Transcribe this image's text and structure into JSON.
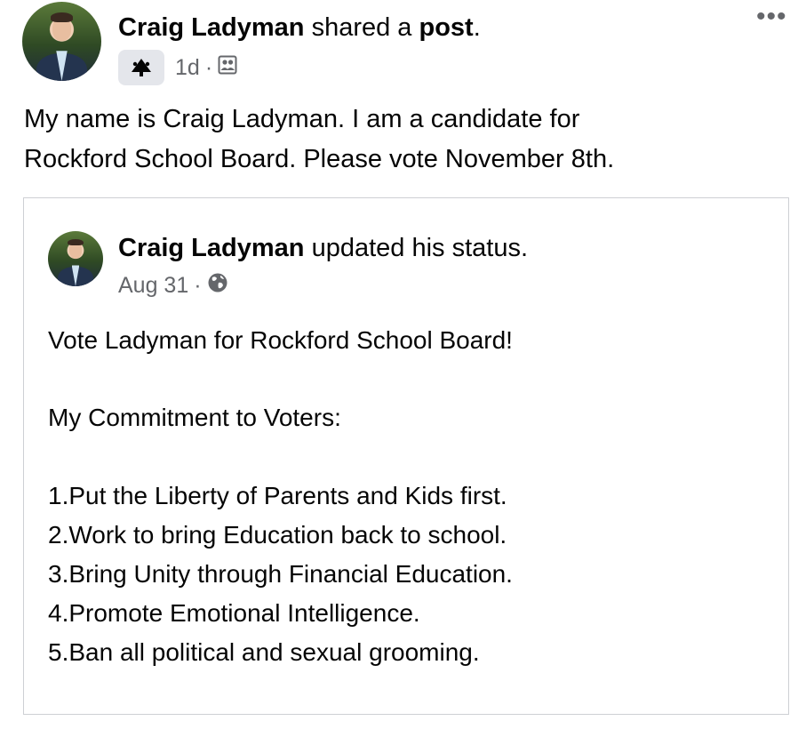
{
  "post": {
    "author": "Craig Ladyman",
    "action_middle": "shared a",
    "action_object": "post",
    "action_end": ".",
    "time": "1d",
    "separator": "·",
    "text_line1": "My name is Craig Ladyman. I am a candidate for",
    "text_line2": "Rockford School Board. Please vote November 8th.",
    "more_label": "•••",
    "badge_icon": "megaphone-icon",
    "audience_icon": "group-icon"
  },
  "shared": {
    "author": "Craig Ladyman",
    "action": "updated his status.",
    "date": "Aug 31",
    "separator": "·",
    "audience_icon": "globe-icon",
    "lines": [
      "Vote Ladyman for Rockford School Board!",
      "My Commitment to Voters:",
      "1.Put the Liberty of Parents and Kids first.",
      "2.Work to bring Education back to school.",
      "3.Bring Unity through Financial Education.",
      "4.Promote Emotional Intelligence.",
      "5.Ban all political and sexual grooming."
    ]
  },
  "colors": {
    "text": "#050505",
    "meta": "#65676b",
    "border": "#ced0d4",
    "badge_bg": "#e4e6eb"
  }
}
